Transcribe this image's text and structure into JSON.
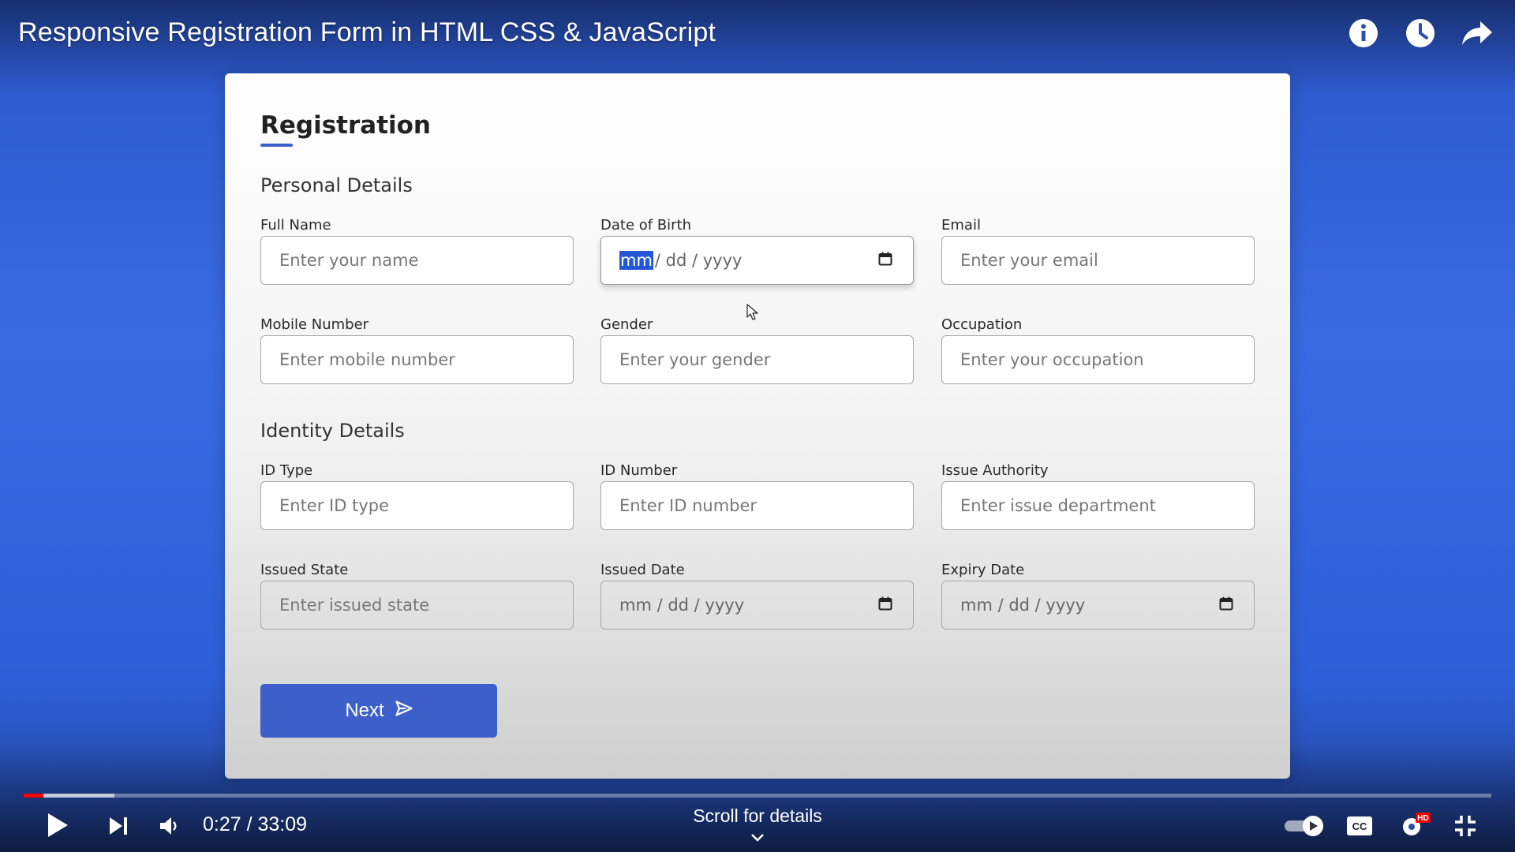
{
  "video": {
    "title": "Responsive Registration Form in HTML CSS & JavaScript",
    "time_current": "0:27",
    "time_total": "33:09",
    "time_display": "0:27 / 33:09",
    "scroll_hint": "Scroll for details",
    "progress_played_fraction": 0.0136,
    "progress_buffered_fraction": 0.0617,
    "hd_badge": "HD",
    "cc_label": "CC"
  },
  "form": {
    "title": "Registration",
    "personal_section": "Personal Details",
    "identity_section": "Identity Details",
    "fields": {
      "full_name": {
        "label": "Full Name",
        "placeholder": "Enter your name"
      },
      "dob": {
        "label": "Date of Birth",
        "mm": "mm",
        "rest": "/ dd / yyyy"
      },
      "email": {
        "label": "Email",
        "placeholder": "Enter your email"
      },
      "mobile": {
        "label": "Mobile Number",
        "placeholder": "Enter mobile number"
      },
      "gender": {
        "label": "Gender",
        "placeholder": "Enter your gender"
      },
      "occupation": {
        "label": "Occupation",
        "placeholder": "Enter your occupation"
      },
      "id_type": {
        "label": "ID Type",
        "placeholder": "Enter ID type"
      },
      "id_number": {
        "label": "ID Number",
        "placeholder": "Enter ID number"
      },
      "issue_authority": {
        "label": "Issue Authority",
        "placeholder": "Enter issue department"
      },
      "issued_state": {
        "label": "Issued State",
        "placeholder": "Enter issued state"
      },
      "issued_date": {
        "label": "Issued Date",
        "value": "mm / dd / yyyy"
      },
      "expiry_date": {
        "label": "Expiry Date",
        "value": "mm / dd / yyyy"
      }
    },
    "next_button": "Next"
  },
  "colors": {
    "accent": "#3d5fc9",
    "background": "#3a6ae2",
    "progress": "#ff0000"
  },
  "icons": {
    "info": "info-icon",
    "watch_later": "clock-icon",
    "share": "share-icon",
    "calendar": "calendar-icon",
    "next": "send-icon"
  }
}
